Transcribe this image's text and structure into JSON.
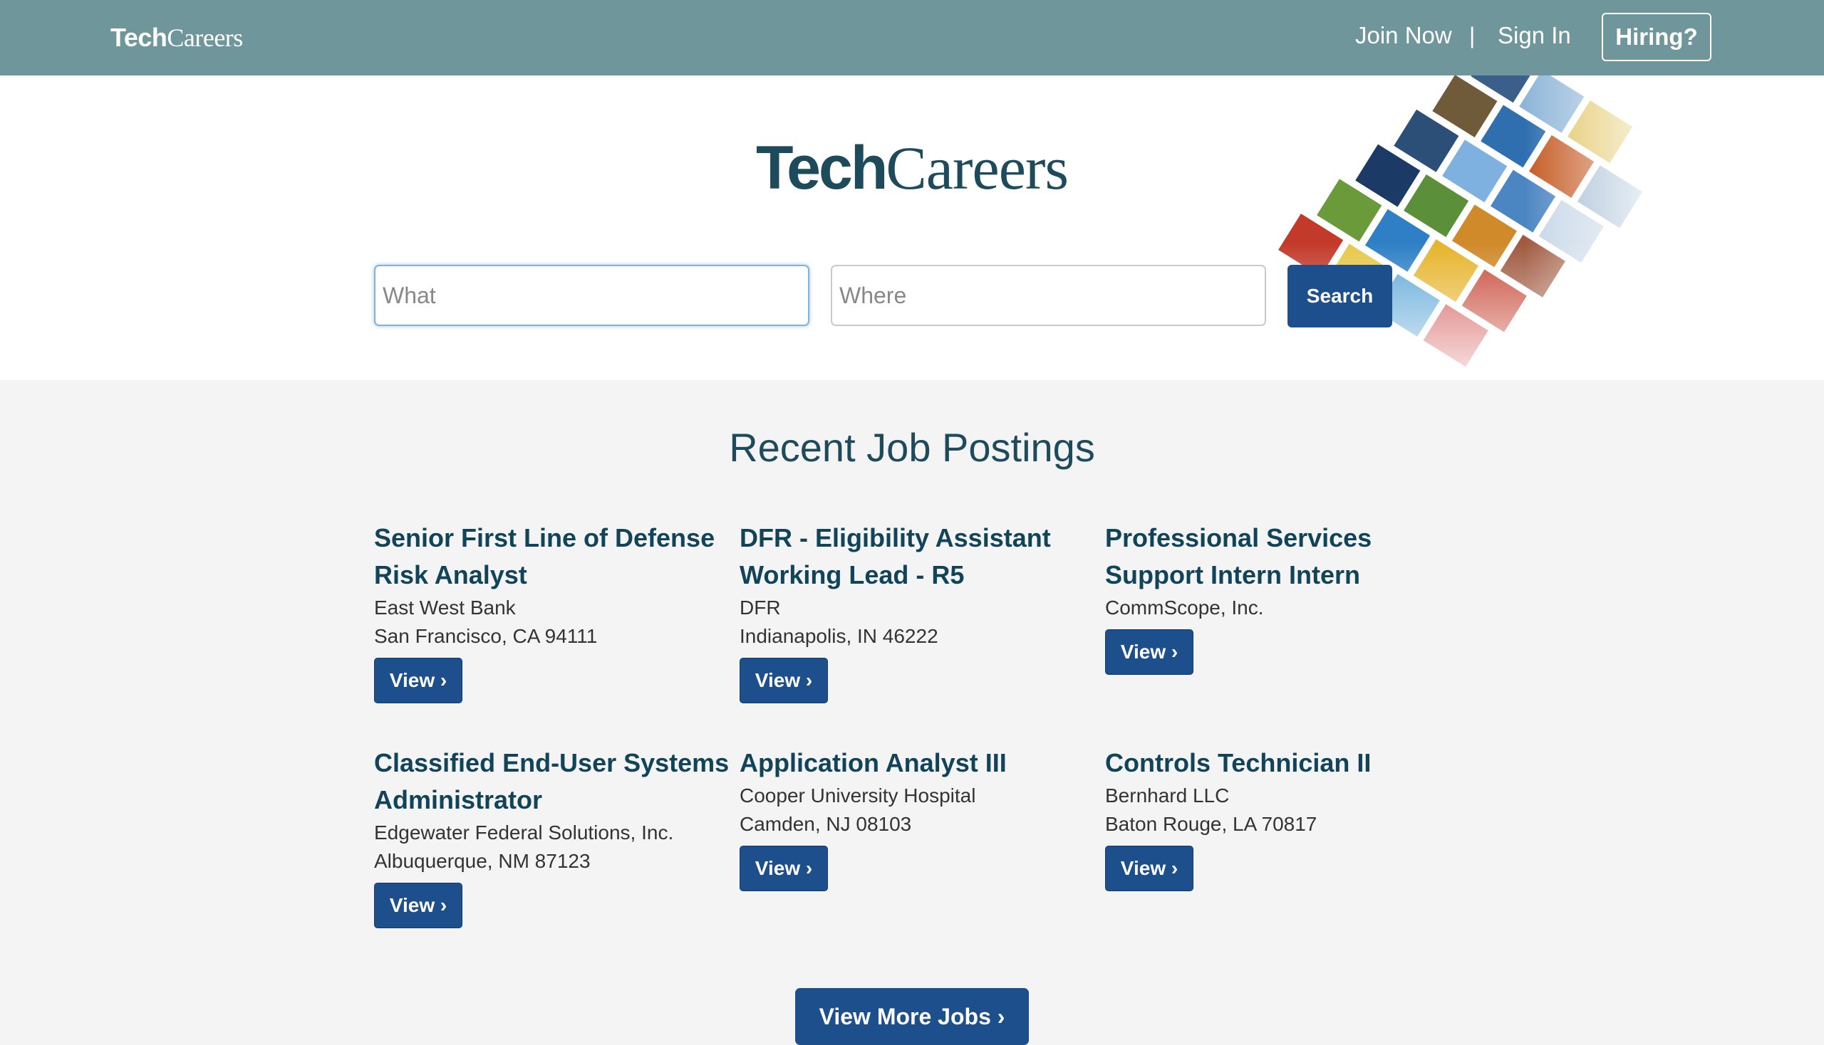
{
  "nav": {
    "logo_tech": "Tech",
    "logo_careers": "Careers",
    "join_label": "Join Now",
    "separator": "|",
    "signin_label": "Sign In",
    "hiring_label": "Hiring?"
  },
  "hero": {
    "logo_tech": "Tech",
    "logo_careers": "Careers"
  },
  "search": {
    "what_placeholder": "What",
    "what_value": "",
    "where_placeholder": "Where",
    "where_value": "",
    "button_label": "Search"
  },
  "jobs_section": {
    "title": "Recent Job Postings",
    "jobs": [
      {
        "title": "Senior First Line of Defense Risk Analyst",
        "company": "East West Bank",
        "location": "San Francisco, CA 94111",
        "view_label": "View ›"
      },
      {
        "title": "DFR - Eligibility Assistant Working Lead - R5",
        "company": "DFR",
        "location": "Indianapolis, IN 46222",
        "view_label": "View ›"
      },
      {
        "title": "Professional Services Support Intern Intern",
        "company": "CommScope, Inc.",
        "location": "",
        "view_label": "View ›"
      },
      {
        "title": "Classified End-User Systems Administrator",
        "company": "Edgewater Federal Solutions, Inc.",
        "location": "Albuquerque, NM 87123",
        "view_label": "View ›"
      },
      {
        "title": "Application Analyst III",
        "company": "Cooper University Hospital",
        "location": "Camden, NJ 08103",
        "view_label": "View ›"
      },
      {
        "title": "Controls Technician II",
        "company": "Bernhard LLC",
        "location": "Baton Rouge, LA 70817",
        "view_label": "View ›"
      }
    ],
    "more_label": "View More Jobs ›"
  },
  "colors": {
    "topbar": "#6f979b",
    "brand_dark": "#1e4b5c",
    "button_blue": "#1d4f8c"
  }
}
